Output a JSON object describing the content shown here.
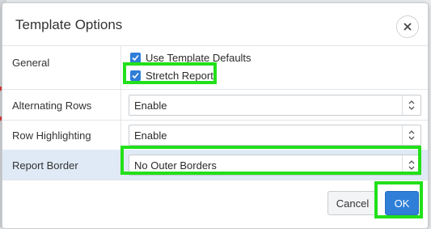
{
  "dialog": {
    "title": "Template Options",
    "close_icon": "close-icon"
  },
  "general": {
    "label": "General",
    "options": [
      {
        "label": "Use Template Defaults",
        "checked": true
      },
      {
        "label": "Stretch Report",
        "checked": true
      }
    ]
  },
  "rows": [
    {
      "label": "Alternating Rows",
      "value": "Enable"
    },
    {
      "label": "Row Highlighting",
      "value": "Enable"
    },
    {
      "label": "Report Border",
      "value": "No Outer Borders"
    }
  ],
  "buttons": {
    "cancel": "Cancel",
    "ok": "OK"
  },
  "colors": {
    "accent": "#2f7ed8",
    "highlight": "#22e01a",
    "selected_row": "#dfeaf6"
  }
}
